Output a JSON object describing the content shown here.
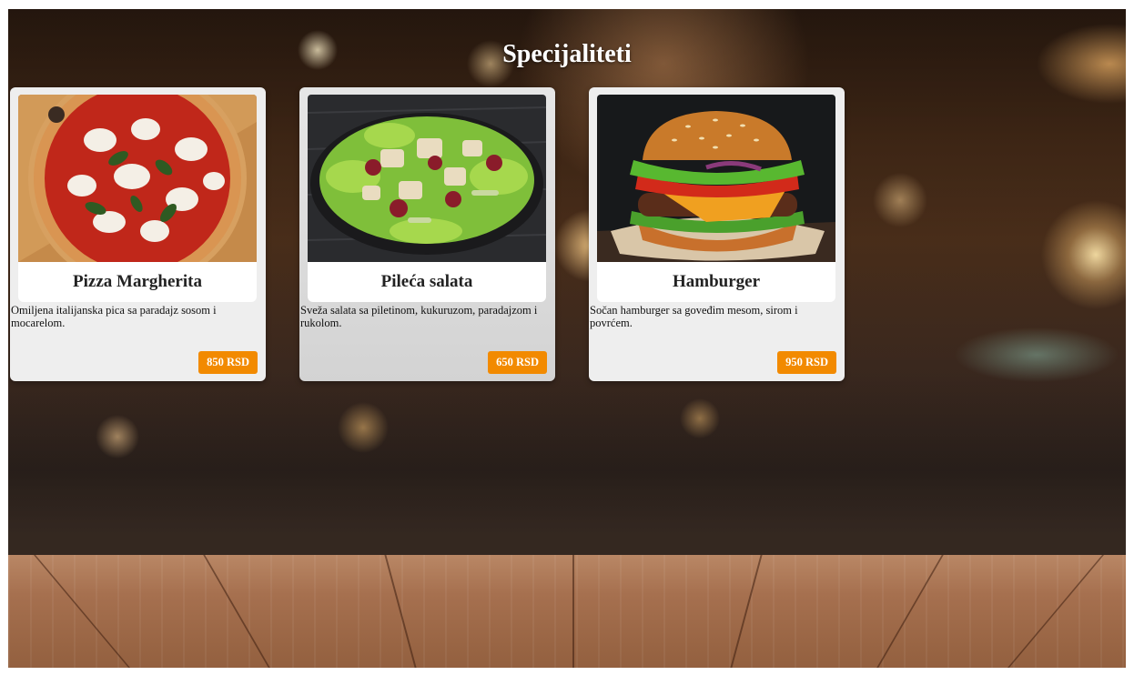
{
  "page": {
    "title": "Specijaliteti"
  },
  "colors": {
    "price_button": "#f28a00",
    "card_background": "#eeeeee",
    "title_text": "#ffffff"
  },
  "items": [
    {
      "name": "Pizza Margherita",
      "description": "Omiljena italijanska pica sa paradajz sosom i mocarelom.",
      "price": "850 RSD",
      "image": "pizza-margherita-photo"
    },
    {
      "name": "Pileća salata",
      "description": "Sveža salata sa piletinom, kukuruzom, paradajzom i rukolom.",
      "price": "650 RSD",
      "image": "chicken-salad-photo"
    },
    {
      "name": "Hamburger",
      "description": "Sočan hamburger sa goveđim mesom, sirom i povrćem.",
      "price": "950 RSD",
      "image": "hamburger-photo"
    }
  ]
}
